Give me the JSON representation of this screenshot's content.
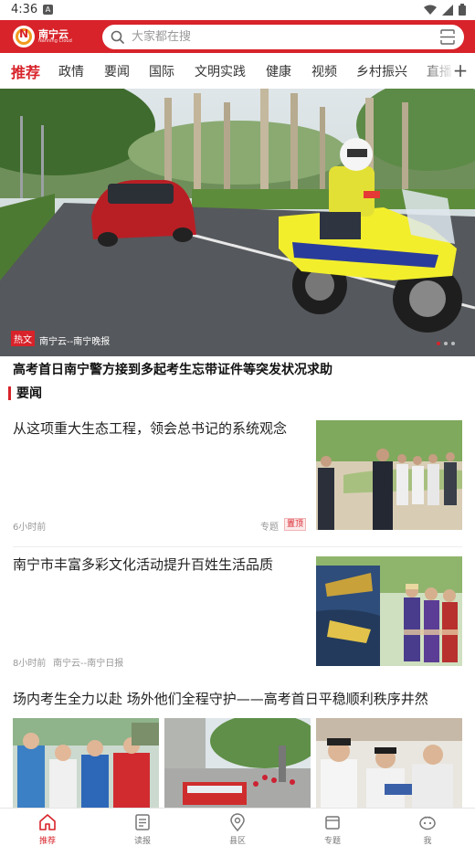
{
  "status_bar": {
    "time": "4:36",
    "notification_glyph": "A"
  },
  "header": {
    "logo_cn": "南宁云",
    "logo_en": "Nanning Cloud",
    "search_placeholder": "大家都在搜",
    "accent_color": "#d8232a"
  },
  "tabs": [
    {
      "label": "推荐",
      "active": true
    },
    {
      "label": "政情"
    },
    {
      "label": "要闻"
    },
    {
      "label": "国际"
    },
    {
      "label": "文明实践"
    },
    {
      "label": "健康"
    },
    {
      "label": "视频"
    },
    {
      "label": "乡村振兴"
    },
    {
      "label": "直播"
    }
  ],
  "tabs_more": "+",
  "hero": {
    "tag": "热文",
    "source": "南宁云--南宁晚报",
    "title": "高考首日南宁警方接到多起考生忘带证件等突发状况求助"
  },
  "section": {
    "title": "要闻"
  },
  "news": [
    {
      "title": "从这项重大生态工程，领会总书记的系统观念",
      "time": "6小时前",
      "topic": "专题",
      "top_tag": "置顶"
    },
    {
      "title": "南宁市丰富多彩文化活动提升百姓生活品质",
      "time": "8小时前",
      "source": "南宁云--南宁日报"
    },
    {
      "title": "场内考生全力以赴 场外他们全程守护——高考首日平稳顺利秩序井然"
    }
  ],
  "bottom_nav": [
    {
      "label": "推荐",
      "icon": "home-icon",
      "active": true
    },
    {
      "label": "读报",
      "icon": "newspaper-icon"
    },
    {
      "label": "县区",
      "icon": "location-icon"
    },
    {
      "label": "专题",
      "icon": "folder-icon"
    },
    {
      "label": "我",
      "icon": "profile-icon"
    }
  ]
}
